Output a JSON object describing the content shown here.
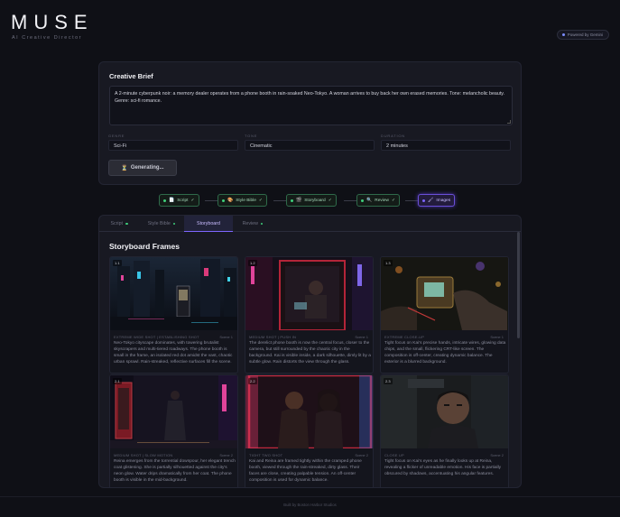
{
  "app": {
    "logo": "MUSE",
    "subtitle": "AI Creative Director",
    "powered_by": "Powered by Gemini"
  },
  "brief": {
    "title": "Creative Brief",
    "text": "A 2-minute cyberpunk noir: a memory dealer operates from a phone booth in rain-soaked Neo-Tokyo. A woman arrives to buy back her own erased memories. Tone: melancholic beauty. Genre: sci-fi romance.",
    "fields": [
      {
        "label": "GENRE",
        "value": "Sci-Fi"
      },
      {
        "label": "TONE",
        "value": "Cinematic"
      },
      {
        "label": "DURATION",
        "value": "2 minutes"
      }
    ],
    "generate_label": "Generating...",
    "generate_icon": "hourglass-icon"
  },
  "pipeline": [
    {
      "label": "Script",
      "icon": "📄",
      "status": "✓"
    },
    {
      "label": "Style Bible",
      "icon": "🎨",
      "status": "✓"
    },
    {
      "label": "Storyboard",
      "icon": "🎬",
      "status": "✓"
    },
    {
      "label": "Review",
      "icon": "🔍",
      "status": "✓"
    },
    {
      "label": "Images",
      "icon": "🖌",
      "status": ""
    }
  ],
  "tabs": [
    {
      "label": "Script"
    },
    {
      "label": "Style Bible"
    },
    {
      "label": "Storyboard"
    },
    {
      "label": "Review"
    }
  ],
  "active_tab": "Storyboard",
  "storyboard": {
    "title": "Storyboard Frames",
    "frames": [
      {
        "num": "1.1",
        "shot": "EXTREME WIDE SHOT | ESTABLISHING SHOT",
        "scene": "Scene 1",
        "desc": "Neo-Tokyo cityscape dominates, with towering brutalist skyscrapers and multi-tiered roadways. The phone booth is small in the frame, an isolated red dot amidst the vast, chaotic urban sprawl. Rain-streaked, reflective surfaces fill the scene."
      },
      {
        "num": "1.2",
        "shot": "MEDIUM SHOT | PUSH IN",
        "scene": "Scene 1",
        "desc": "The derelict phone booth is now the central focus, closer to the camera, but still surrounded by the chaotic city in the background. Kai is visible inside, a dark silhouette, dimly lit by a subtle glow. Rain distorts the view through the glass."
      },
      {
        "num": "1.3",
        "shot": "EXTREME CLOSE-UP",
        "scene": "Scene 1",
        "desc": "Tight focus on Kai's precise hands, intricate wires, glowing data chips, and the small, flickering CRT-like screen. The composition is off-center, creating dynamic balance. The exterior is a blurred background."
      },
      {
        "num": "2.1",
        "shot": "MEDIUM SHOT | SLOW MOTION",
        "scene": "Scene 2",
        "desc": "Reina emerges from the torrential downpour, her elegant trench coat glistening. She is partially silhouetted against the city's neon glow. Water drips dramatically from her coat. The phone booth is visible in the mid-background."
      },
      {
        "num": "2.2",
        "shot": "TIGHT TWO SHOT",
        "scene": "Scene 2",
        "desc": "Kai and Reina are framed tightly within the cramped phone booth, viewed through the rain-streaked, dirty glass. Their faces are close, creating palpable tension. An off-center composition is used for dynamic balance."
      },
      {
        "num": "2.3",
        "shot": "CLOSE UP",
        "scene": "Scene 2",
        "desc": "Tight focus on Kai's eyes as he finally looks up at Reina, revealing a flicker of unreadable emotion. His face is partially obscured by shadows, accentuating his angular features."
      }
    ]
  },
  "footer": "Built by Boston Harbor Studios",
  "colors": {
    "background": "#0f1016",
    "panel": "#181922",
    "success": "#3fcf7b",
    "accent": "#7d66ff"
  }
}
